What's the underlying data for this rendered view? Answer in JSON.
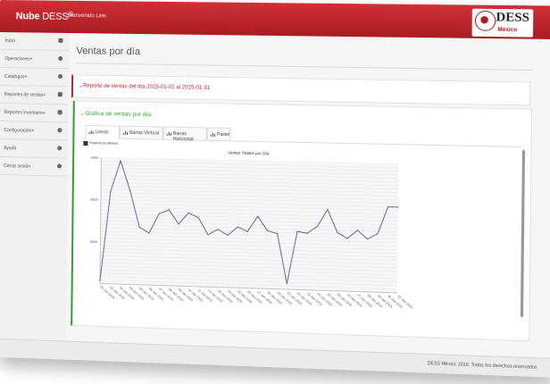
{
  "header": {
    "brand_bold": "Nube",
    "brand_rest": "DESS",
    "brand_mark": "®",
    "welcome": "Bienvenido Lirei",
    "logo_text": "DESS",
    "logo_sub": "México"
  },
  "sidebar": {
    "items": [
      {
        "label": "Inicio",
        "icon": "home-icon"
      },
      {
        "label": "Operaciones+",
        "icon": "gear-icon"
      },
      {
        "label": "Catalogos+",
        "icon": "gear-icon"
      },
      {
        "label": "Reportes de ventas+",
        "icon": "chart-icon"
      },
      {
        "label": "Reportes inventario+",
        "icon": "chart-icon"
      },
      {
        "label": "Configuración+",
        "icon": "gear-icon"
      },
      {
        "label": "Ayuda",
        "icon": "question-icon"
      },
      {
        "label": "Cerrar sesión",
        "icon": "power-icon"
      }
    ]
  },
  "page": {
    "title": "Ventas por día",
    "report_title": "Reporte de ventas del día 2015-01-01 al 2015-01-31",
    "chart_panel_title": "Grafica de ventas por día"
  },
  "tabs": [
    {
      "label": "Lineas",
      "icon": "line-chart-icon",
      "active": true
    },
    {
      "label": "Barras Vertical",
      "icon": "bar-chart-icon",
      "active": false
    },
    {
      "label": "Barras Horizontal",
      "icon": "hbar-chart-icon",
      "active": false
    },
    {
      "label": "Pastel",
      "icon": "pie-chart-icon",
      "active": false
    }
  ],
  "chart_badge": "Powered by Webcel",
  "chart_data": {
    "type": "line",
    "title": "Ventas Totales por Día",
    "xlabel": "",
    "ylabel": "",
    "ylim": [
      0,
      9000
    ],
    "yticks": [
      3000,
      6000,
      9000
    ],
    "grid": true,
    "categories": [
      "01-Jan-2015",
      "02-Jan-2015",
      "03-Jan-2015",
      "04-Jan-2015",
      "05-Jan-2015",
      "06-Jan-2015",
      "07-Jan-2015",
      "08-Jan-2015",
      "09-Jan-2015",
      "10-Jan-2015",
      "11-Jan-2015",
      "12-Jan-2015",
      "13-Jan-2015",
      "14-Jan-2015",
      "15-Jan-2015",
      "16-Jan-2015",
      "17-Jan-2015",
      "18-Jan-2015",
      "19-Jan-2015",
      "20-Jan-2015",
      "21-Jan-2015",
      "22-Jan-2015",
      "23-Jan-2015",
      "24-Jan-2015",
      "25-Jan-2015",
      "26-Jan-2015",
      "27-Jan-2015",
      "28-Jan-2015",
      "29-Jan-2015",
      "30-Jan-2015",
      "31-Jan-2015"
    ],
    "values": [
      200,
      6600,
      8800,
      6700,
      4100,
      3700,
      5100,
      5400,
      4400,
      5200,
      4900,
      3700,
      4100,
      3700,
      4300,
      4000,
      5100,
      4100,
      3900,
      400,
      4100,
      4000,
      4500,
      5700,
      4100,
      3700,
      4300,
      3700,
      4100,
      6000,
      6000
    ],
    "color": "#6b6b86"
  },
  "footer": {
    "text": "DESS México 2016. Todos los derechos reservados"
  }
}
